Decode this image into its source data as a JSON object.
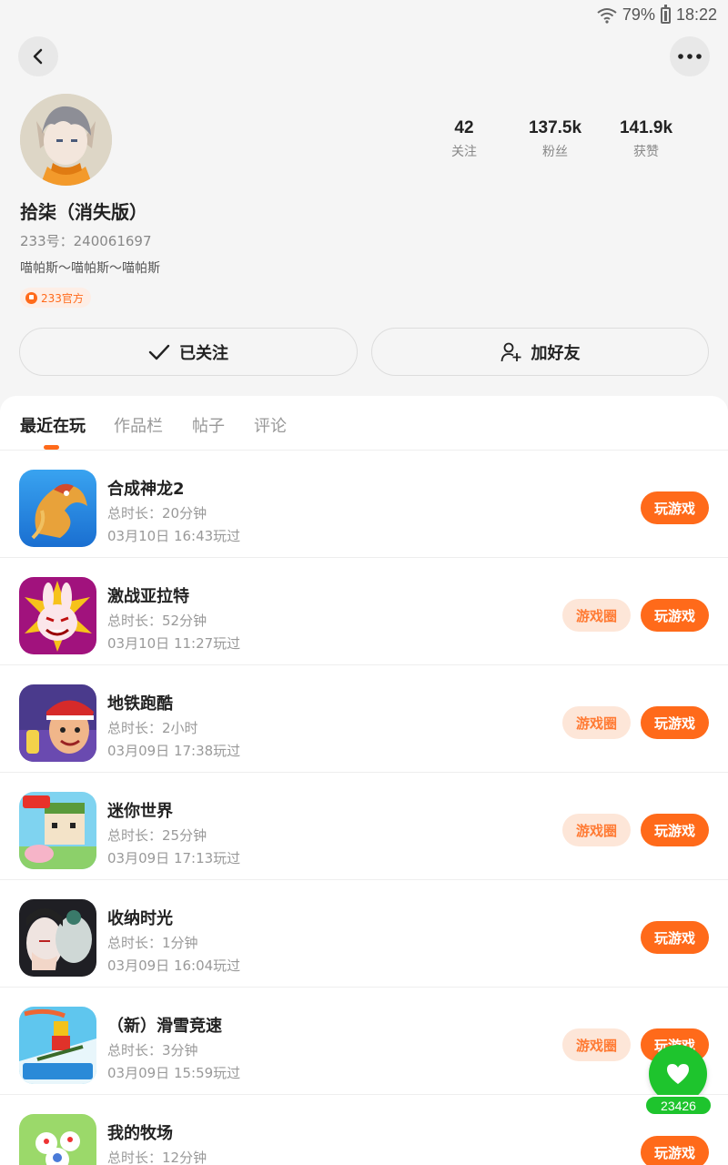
{
  "status_bar": {
    "battery": "79%",
    "time": "18:22",
    "icons": [
      "wifi-icon",
      "battery-icon"
    ]
  },
  "header": {
    "back_icon": "chevron-left-icon",
    "more_icon": "more-horizontal-icon"
  },
  "profile": {
    "nickname": "拾柒（消失版）",
    "uid": "233号：240061697",
    "bio": "喵帕斯～喵帕斯～喵帕斯",
    "badge": "233官方",
    "stats": [
      {
        "value": "42",
        "label": "关注"
      },
      {
        "value": "137.5k",
        "label": "粉丝"
      },
      {
        "value": "141.9k",
        "label": "获赞"
      }
    ],
    "followed_label": "已关注",
    "add_friend_label": "加好友"
  },
  "tabs": [
    {
      "label": "最近在玩",
      "active": true
    },
    {
      "label": "作品栏",
      "active": false
    },
    {
      "label": "帖子",
      "active": false
    },
    {
      "label": "评论",
      "active": false
    }
  ],
  "games": [
    {
      "title": "合成神龙2",
      "duration": "总时长：20分钟",
      "last_played": "03月10日 16:43玩过",
      "has_circle": false,
      "play_label": "玩游戏",
      "circle_label": ""
    },
    {
      "title": "激战亚拉特",
      "duration": "总时长：52分钟",
      "last_played": "03月10日 11:27玩过",
      "has_circle": true,
      "play_label": "玩游戏",
      "circle_label": "游戏圈"
    },
    {
      "title": "地铁跑酷",
      "duration": "总时长：2小时",
      "last_played": "03月09日 17:38玩过",
      "has_circle": true,
      "play_label": "玩游戏",
      "circle_label": "游戏圈"
    },
    {
      "title": "迷你世界",
      "duration": "总时长：25分钟",
      "last_played": "03月09日 17:13玩过",
      "has_circle": true,
      "play_label": "玩游戏",
      "circle_label": "游戏圈"
    },
    {
      "title": "收纳时光",
      "duration": "总时长：1分钟",
      "last_played": "03月09日 16:04玩过",
      "has_circle": false,
      "play_label": "玩游戏",
      "circle_label": ""
    },
    {
      "title": "（新）滑雪竞速",
      "duration": "总时长：3分钟",
      "last_played": "03月09日 15:59玩过",
      "has_circle": true,
      "play_label": "玩游戏",
      "circle_label": "游戏圈"
    },
    {
      "title": "我的牧场",
      "duration": "总时长：12分钟",
      "last_played": "",
      "has_circle": false,
      "play_label": "玩游戏",
      "circle_label": ""
    }
  ],
  "floating_like": {
    "count": "23426",
    "icon": "heart-icon"
  },
  "colors": {
    "accent": "#ff6a1a",
    "accent_light": "#fde6d8",
    "like_green": "#1ec42d",
    "text_primary": "#222222",
    "text_secondary": "#999999"
  }
}
